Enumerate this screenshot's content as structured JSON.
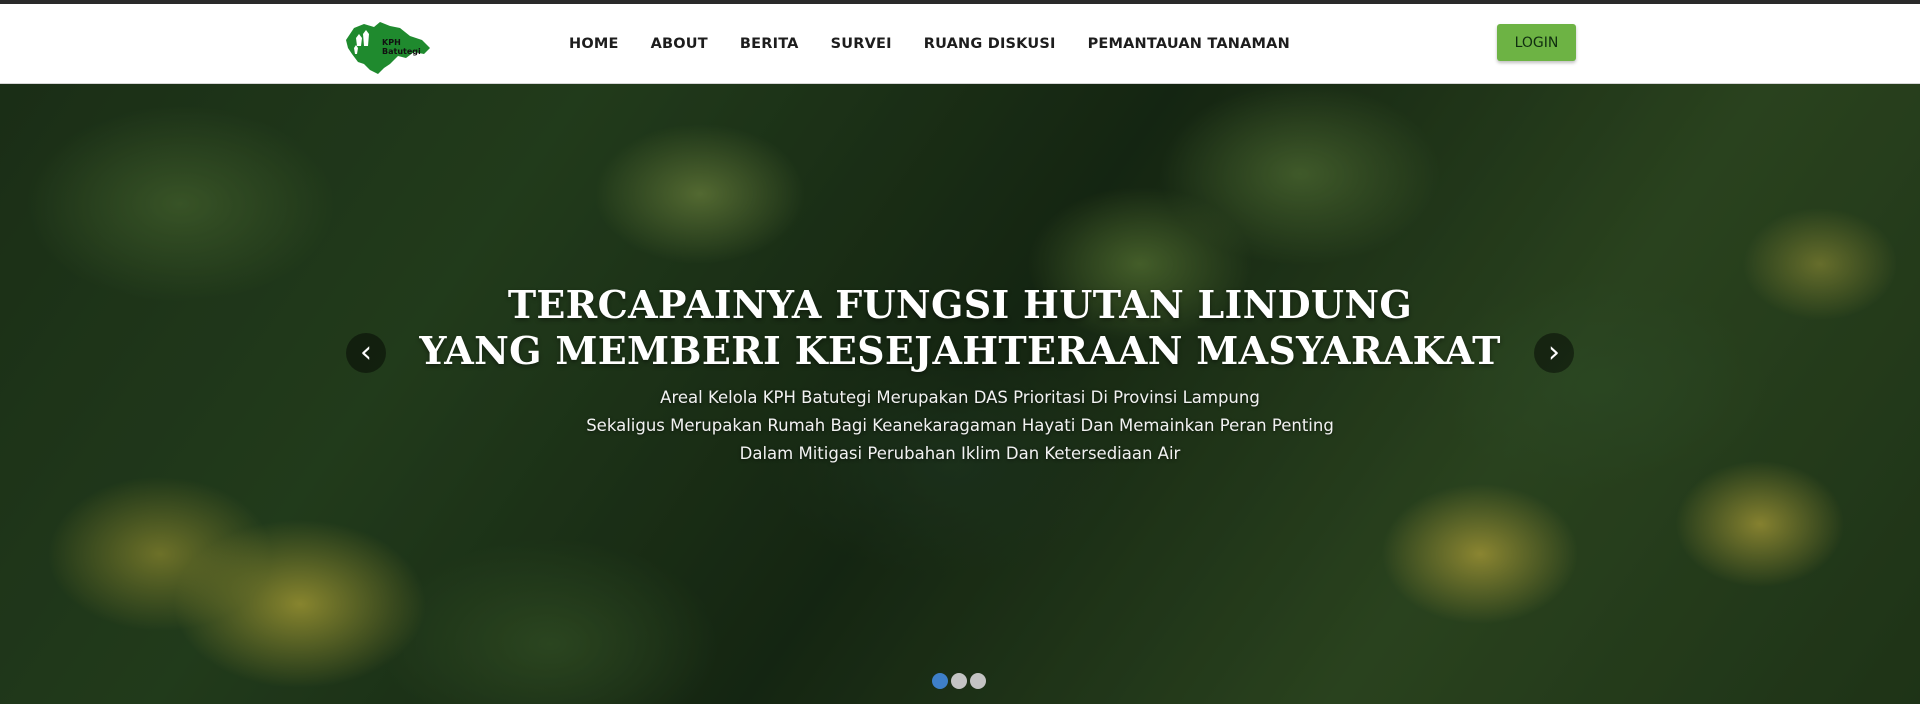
{
  "brand": {
    "logo_text_1": "KPH",
    "logo_text_2": "Batutegi",
    "logo_color": "#1f8a2e"
  },
  "nav": {
    "items": [
      {
        "label": "HOME"
      },
      {
        "label": "ABOUT"
      },
      {
        "label": "BERITA"
      },
      {
        "label": "SURVEI"
      },
      {
        "label": "RUANG DISKUSI"
      },
      {
        "label": "PEMANTAUAN TANAMAN"
      }
    ],
    "login_label": "LOGIN",
    "login_color": "#6db344"
  },
  "hero": {
    "title_line_1": "TERCAPAINYA FUNGSI HUTAN LINDUNG",
    "title_line_2": "YANG MEMBERI KESEJAHTERAAN MASYARAKAT",
    "desc_line_1": "Areal Kelola KPH Batutegi Merupakan DAS Prioritasi Di Provinsi Lampung",
    "desc_line_2": "Sekaligus Merupakan Rumah Bagi Keanekaragaman Hayati Dan Memainkan Peran Penting",
    "desc_line_3": "Dalam Mitigasi Perubahan Iklim Dan Ketersediaan Air",
    "prev_glyph": "‹",
    "next_glyph": "›",
    "background": "aerial-forest-photo",
    "slides_total": 3,
    "active_slide": 1,
    "active_dot_color": "#3e7fc8"
  }
}
